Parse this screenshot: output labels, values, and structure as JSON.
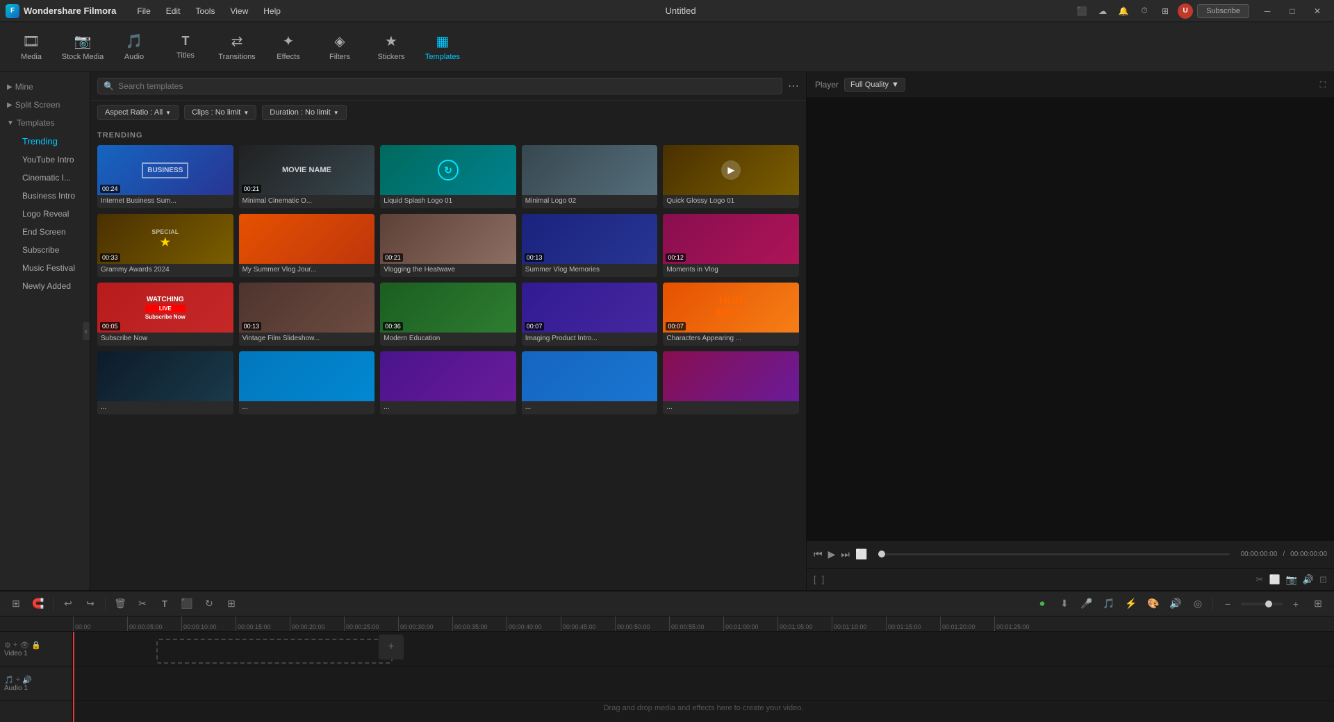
{
  "app": {
    "name": "Wondershare Filmora",
    "title": "Untitled"
  },
  "titlebar": {
    "menu": [
      "File",
      "Edit",
      "Tools",
      "View",
      "Help"
    ],
    "subscribe_label": "Subscribe"
  },
  "toolbar": {
    "tools": [
      {
        "id": "media",
        "label": "Media",
        "icon": "🎞"
      },
      {
        "id": "stock",
        "label": "Stock Media",
        "icon": "📷"
      },
      {
        "id": "audio",
        "label": "Audio",
        "icon": "🎵"
      },
      {
        "id": "titles",
        "label": "Titles",
        "icon": "T"
      },
      {
        "id": "transitions",
        "label": "Transitions",
        "icon": "⇄"
      },
      {
        "id": "effects",
        "label": "Effects",
        "icon": "✦"
      },
      {
        "id": "filters",
        "label": "Filters",
        "icon": "◈"
      },
      {
        "id": "stickers",
        "label": "Stickers",
        "icon": "★"
      },
      {
        "id": "templates",
        "label": "Templates",
        "icon": "▦"
      }
    ]
  },
  "sidebar": {
    "mine_label": "Mine",
    "split_screen_label": "Split Screen",
    "templates_label": "Templates",
    "sub_items": [
      {
        "id": "trending",
        "label": "Trending",
        "active": true
      },
      {
        "id": "youtube",
        "label": "YouTube Intro"
      },
      {
        "id": "cinematic",
        "label": "Cinematic I..."
      },
      {
        "id": "business",
        "label": "Business Intro"
      },
      {
        "id": "logo",
        "label": "Logo Reveal"
      },
      {
        "id": "endscreen",
        "label": "End Screen"
      },
      {
        "id": "subscribe",
        "label": "Subscribe"
      },
      {
        "id": "music",
        "label": "Music Festival"
      },
      {
        "id": "newlyadded",
        "label": "Newly Added"
      }
    ]
  },
  "search": {
    "placeholder": "Search templates",
    "more_icon": "⋯"
  },
  "filters": {
    "aspect_ratio": "Aspect Ratio : All",
    "clips": "Clips : No limit",
    "duration": "Duration : No limit"
  },
  "trending_label": "TRENDING",
  "templates": [
    {
      "id": 1,
      "label": "Internet Business Sum...",
      "duration": "00:24",
      "color": "t-blue"
    },
    {
      "id": 2,
      "label": "Minimal Cinematic O...",
      "duration": "00:21",
      "color": "t-dark"
    },
    {
      "id": 3,
      "label": "Liquid Splash Logo 01",
      "duration": "",
      "color": "t-teal"
    },
    {
      "id": 4,
      "label": "Minimal Logo 02",
      "duration": "",
      "color": "t-gray"
    },
    {
      "id": 5,
      "label": "Quick Glossy Logo 01",
      "duration": "",
      "color": "t-gold"
    },
    {
      "id": 6,
      "label": "Grammy Awards 2024",
      "duration": "00:33",
      "color": "t-gold"
    },
    {
      "id": 7,
      "label": "My Summer Vlog Jour...",
      "duration": "",
      "color": "t-summer"
    },
    {
      "id": 8,
      "label": "Vlogging the Heatwave",
      "duration": "00:21",
      "color": "t-desert"
    },
    {
      "id": 9,
      "label": "Summer Vlog Memories",
      "duration": "00:13",
      "color": "t-vlog"
    },
    {
      "id": 10,
      "label": "Moments in Vlog",
      "duration": "00:12",
      "color": "t-pink"
    },
    {
      "id": 11,
      "label": "Subscribe Now",
      "duration": "00:05",
      "color": "t-subscribe"
    },
    {
      "id": 12,
      "label": "Vintage Film Slideshow...",
      "duration": "00:13",
      "color": "t-vintage"
    },
    {
      "id": 13,
      "label": "Modern Education",
      "duration": "00:36",
      "color": "t-edu"
    },
    {
      "id": 14,
      "label": "Imaging Product Intro...",
      "duration": "00:07",
      "color": "t-product"
    },
    {
      "id": 15,
      "label": "Characters Appearing ...",
      "duration": "00:07",
      "color": "t-chars"
    },
    {
      "id": 16,
      "label": "...",
      "duration": "",
      "color": "t-sci"
    },
    {
      "id": 17,
      "label": "...",
      "duration": "",
      "color": "t-corp"
    },
    {
      "id": 18,
      "label": "...",
      "duration": "",
      "color": "t-wedding"
    },
    {
      "id": 19,
      "label": "...",
      "duration": "",
      "color": "t-math"
    },
    {
      "id": 20,
      "label": "...",
      "duration": "",
      "color": "t-outro"
    }
  ],
  "player": {
    "label": "Player",
    "quality": "Full Quality",
    "time_current": "00:00:00:00",
    "time_total": "00:00:00:00"
  },
  "timeline": {
    "ruler_marks": [
      "00:00",
      "00:00:05:00",
      "00:00:10:00",
      "00:00:15:00",
      "00:00:20:00",
      "00:00:25:00",
      "00:00:30:00",
      "00:00:35:00",
      "00:00:40:00",
      "00:00:45:00",
      "00:00:50:00",
      "00:00:55:00",
      "00:01:00:00",
      "00:01:05:00",
      "00:01:10:00",
      "00:01:15:00",
      "00:01:20:00",
      "00:01:25:00"
    ],
    "tracks": [
      {
        "id": "video1",
        "label": "Video 1"
      },
      {
        "id": "audio1",
        "label": "Audio 1"
      }
    ],
    "drop_text": "Drag and drop media and effects here to create your video."
  }
}
